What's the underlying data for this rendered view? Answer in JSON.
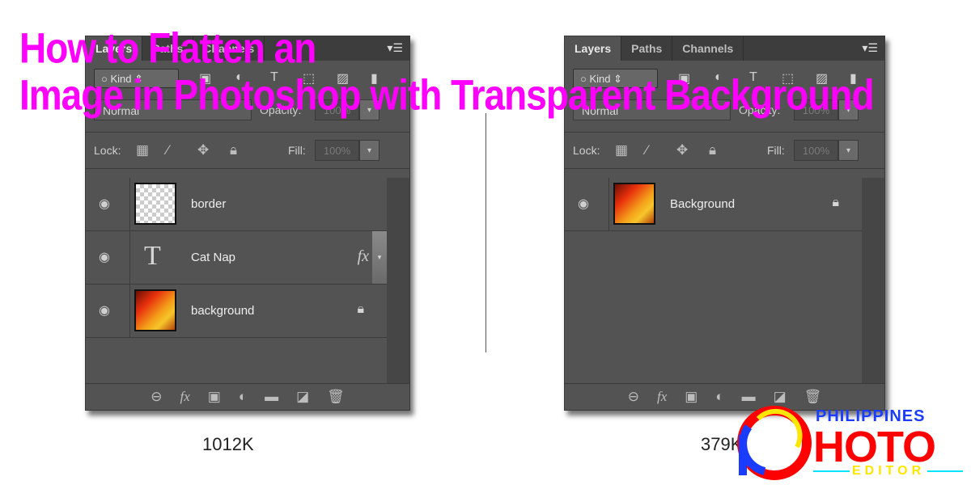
{
  "title": {
    "line1": "How to Flatten an",
    "line2": "Image in Photoshop with Transparent Background"
  },
  "panels": [
    {
      "tabs": [
        "Layers",
        "Paths",
        "Channels"
      ],
      "filter": "Kind",
      "blend_mode": "Normal",
      "opacity_label": "Opacity:",
      "opacity": "100%",
      "lock_label": "Lock:",
      "fill_label": "Fill:",
      "fill": "100%",
      "layers": [
        {
          "name": "border",
          "type": "transparent"
        },
        {
          "name": "Cat Nap",
          "type": "text",
          "fx": "fx"
        },
        {
          "name": "background",
          "type": "image",
          "locked": true
        }
      ],
      "file_size": "1012K"
    },
    {
      "tabs": [
        "Layers",
        "Paths",
        "Channels"
      ],
      "filter": "Kind",
      "blend_mode": "Normal",
      "opacity_label": "Opacity:",
      "opacity": "100%",
      "lock_label": "Lock:",
      "fill_label": "Fill:",
      "fill": "100%",
      "layers": [
        {
          "name": "Background",
          "type": "image",
          "locked": true
        }
      ],
      "file_size": "379K"
    }
  ],
  "logo": {
    "top": "PHILIPPINES",
    "main": "HOTO",
    "bottom": "EDITOR",
    "colors": {
      "red": "#ff0000",
      "blue": "#1a3cff",
      "yellow": "#ffe600",
      "cyan": "#00e5ff"
    }
  }
}
